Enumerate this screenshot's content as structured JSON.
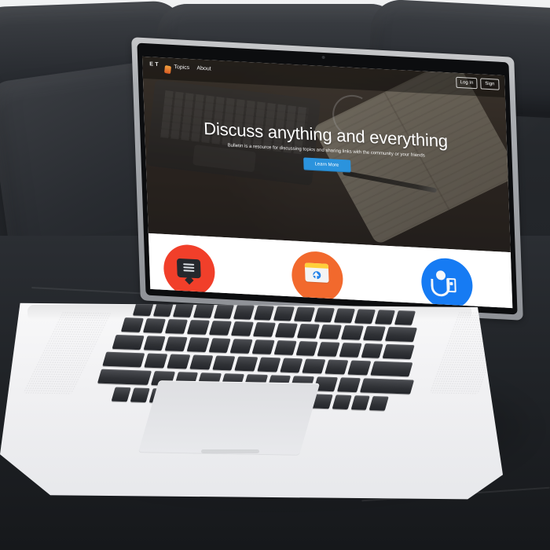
{
  "website": {
    "nav": {
      "brand": "E T",
      "links": [
        "Topics",
        "About"
      ],
      "actions": [
        "Log In",
        "Sign"
      ]
    },
    "hero": {
      "title": "Discuss anything and everything",
      "subtitle": "Bulletin is a resource for discussing topics and sharing links with the community or your friends",
      "cta": "Learn More"
    },
    "features": [
      {
        "icon": "chat-icon",
        "color": "#f13f2a"
      },
      {
        "icon": "browser-icon",
        "color": "#f2692d"
      },
      {
        "icon": "person-device-icon",
        "color": "#167bf3"
      }
    ]
  }
}
